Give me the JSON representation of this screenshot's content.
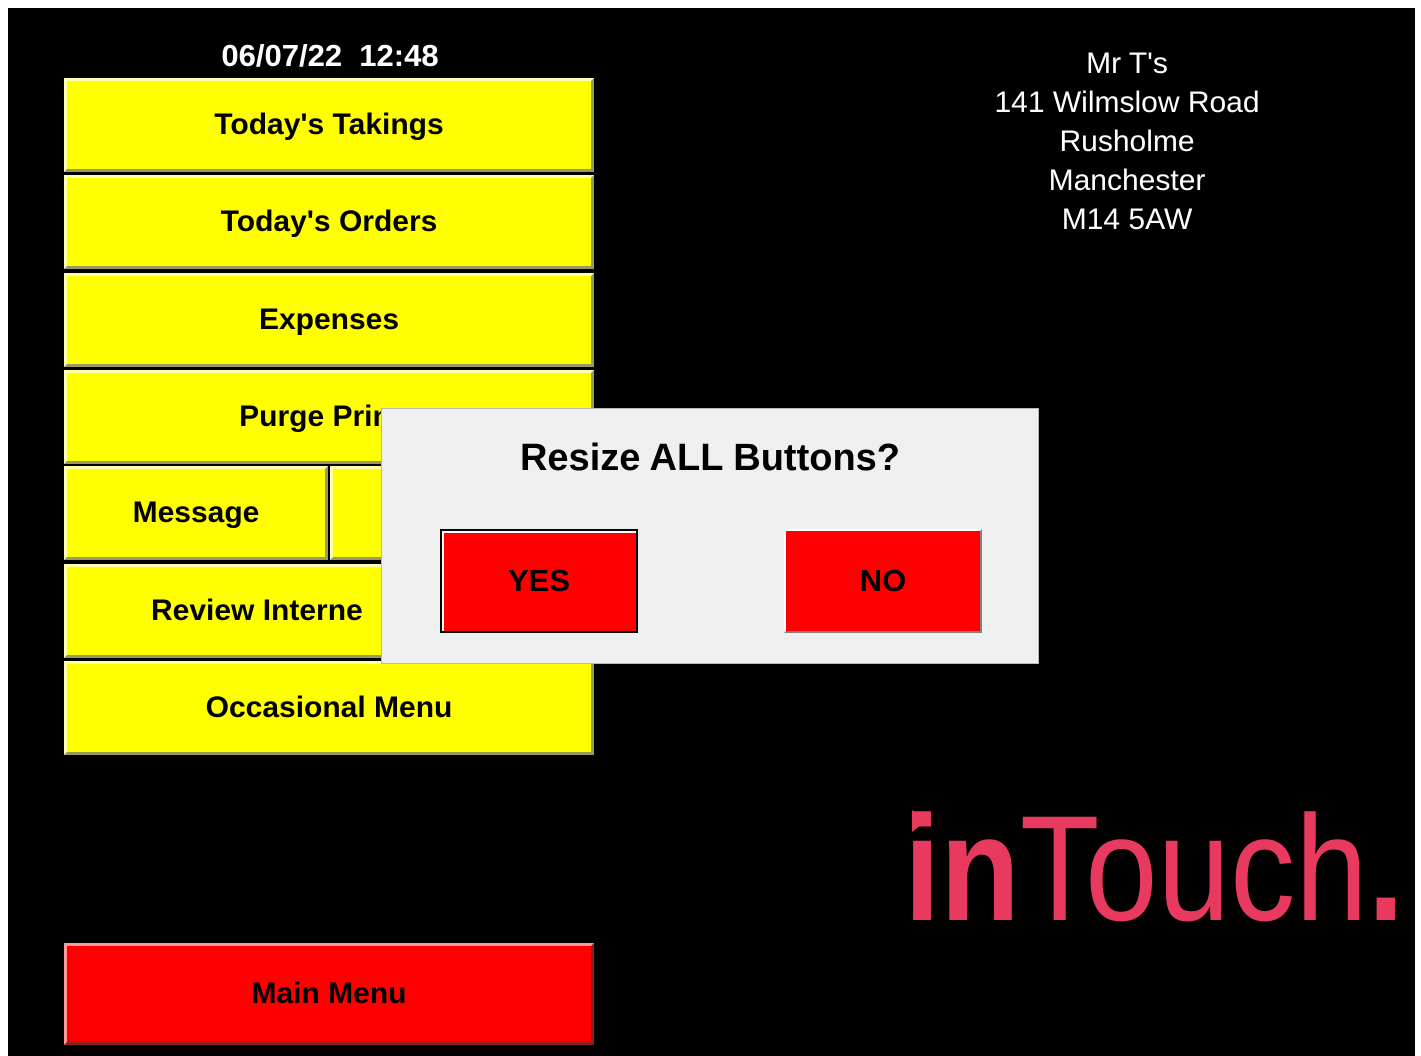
{
  "header": {
    "datetime": "06/07/22  12:48"
  },
  "menu": {
    "todays_takings": "Today's Takings",
    "todays_orders": "Today's Orders",
    "expenses": "Expenses",
    "purge_print": "Purge Prin",
    "message": "Message",
    "review_internet": "Review Interne",
    "occasional_menu": "Occasional Menu",
    "main_menu": "Main Menu"
  },
  "store": {
    "name": "Mr T's",
    "line1": "141 Wilmslow Road",
    "line2": "Rusholme",
    "line3": "Manchester",
    "postcode": "M14 5AW"
  },
  "logo": {
    "part1": "in",
    "part2": "Touch",
    "dot": ".",
    "color": "#e83a5e"
  },
  "dialog": {
    "title": "Resize ALL Buttons?",
    "yes_label": "YES",
    "no_label": "NO"
  },
  "colors": {
    "background": "#000000",
    "menu_button": "#ffff00",
    "main_menu_button": "#ff0000",
    "dialog_button": "#ff0000",
    "dialog_background": "#efefef"
  }
}
